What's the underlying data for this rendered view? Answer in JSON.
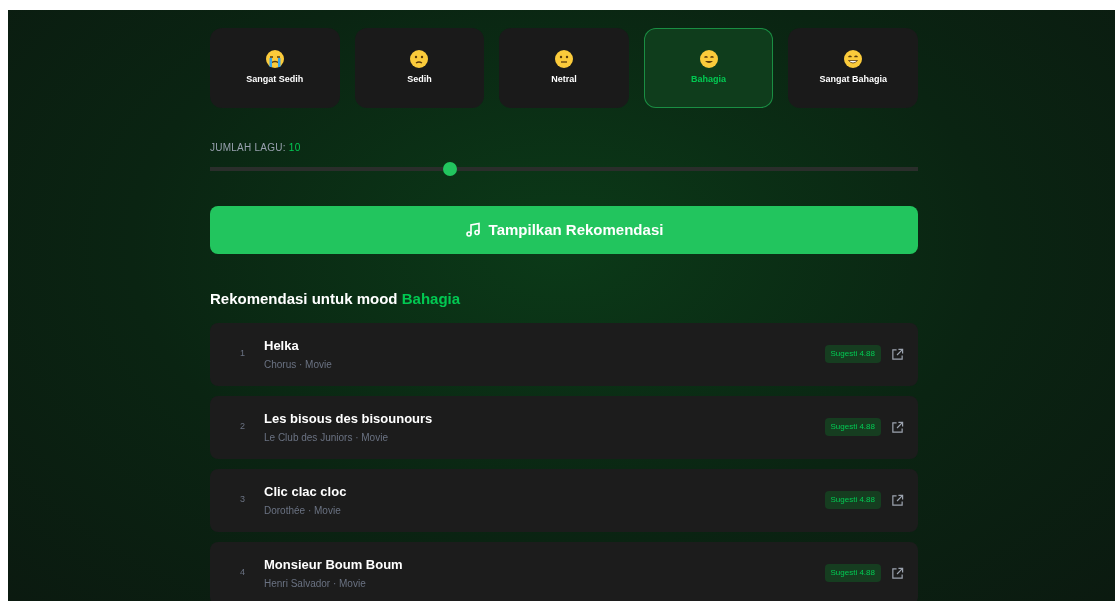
{
  "moods": [
    {
      "label": "Sangat Sedih",
      "kind": "crying",
      "selected": false
    },
    {
      "label": "Sedih",
      "kind": "sad",
      "selected": false
    },
    {
      "label": "Netral",
      "kind": "neutral",
      "selected": false
    },
    {
      "label": "Bahagia",
      "kind": "smile",
      "selected": true
    },
    {
      "label": "Sangat Bahagia",
      "kind": "grin",
      "selected": false
    }
  ],
  "slider": {
    "label": "JUMLAH LAGU:",
    "value": "10",
    "level": 0.336
  },
  "button": {
    "label": "Tampilkan Rekomendasi"
  },
  "heading": {
    "text": "Rekomendasi untuk mood",
    "mood": "Bahagia"
  },
  "songs": [
    {
      "number": "1",
      "title": "Helka",
      "subtitle": "Chorus · Movie",
      "badge": "Sugesti 4.88"
    },
    {
      "number": "2",
      "title": "Les bisous des bisounours",
      "subtitle": "Le Club des Juniors · Movie",
      "badge": "Sugesti 4.88"
    },
    {
      "number": "3",
      "title": "Clic clac cloc",
      "subtitle": "Dorothée · Movie",
      "badge": "Sugesti 4.88"
    },
    {
      "number": "4",
      "title": "Monsieur Boum Boum",
      "subtitle": "Henri Salvador · Movie",
      "badge": "Sugesti 4.88"
    }
  ]
}
